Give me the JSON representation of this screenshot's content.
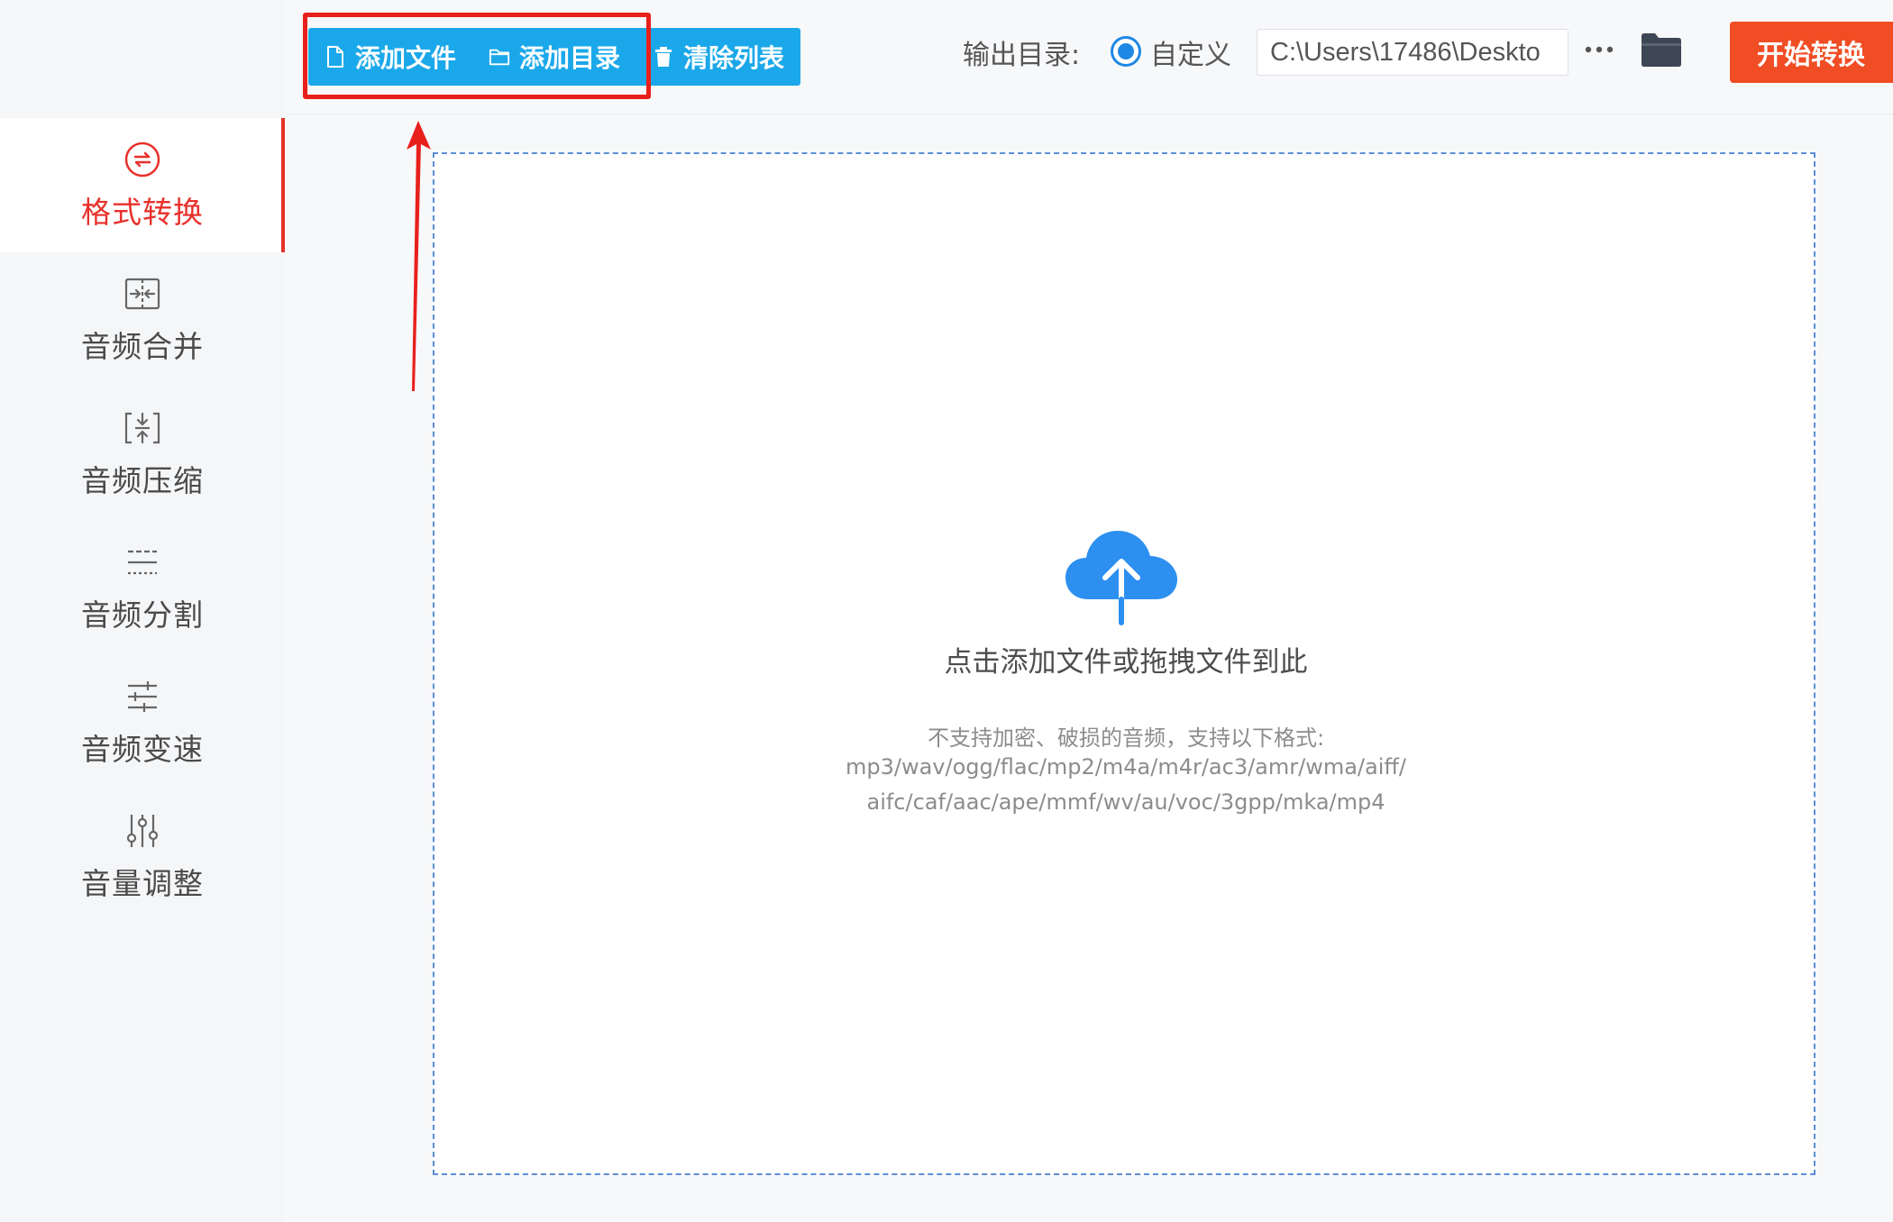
{
  "toolbar": {
    "add_file": "添加文件",
    "add_folder": "添加目录",
    "clear_list": "清除列表",
    "output_label": "输出目录:",
    "output_option": "自定义",
    "output_path": "C:\\Users\\17486\\Deskto",
    "start_label": "开始转换"
  },
  "sidebar": {
    "items": [
      {
        "label": "格式转换",
        "icon": "convert-icon",
        "active": true
      },
      {
        "label": "音频合并",
        "icon": "merge-icon",
        "active": false
      },
      {
        "label": "音频压缩",
        "icon": "compress-icon",
        "active": false
      },
      {
        "label": "音频分割",
        "icon": "split-icon",
        "active": false
      },
      {
        "label": "音频变速",
        "icon": "speed-icon",
        "active": false
      },
      {
        "label": "音量调整",
        "icon": "volume-icon",
        "active": false
      }
    ]
  },
  "dropzone": {
    "title": "点击添加文件或拖拽文件到此",
    "note": "不支持加密、破损的音频，支持以下格式:",
    "formats_line1": "mp3/wav/ogg/flac/mp2/m4a/m4r/ac3/amr/wma/aiff/",
    "formats_line2": "aifc/caf/aac/ape/mmf/wv/au/voc/3gpp/mka/mp4"
  },
  "colors": {
    "accent": "#e8302a",
    "primary_button": "#1ba8ea",
    "start_button": "#f04d24",
    "upload_icon": "#2d8ff0",
    "annotation": "#e8201c"
  }
}
